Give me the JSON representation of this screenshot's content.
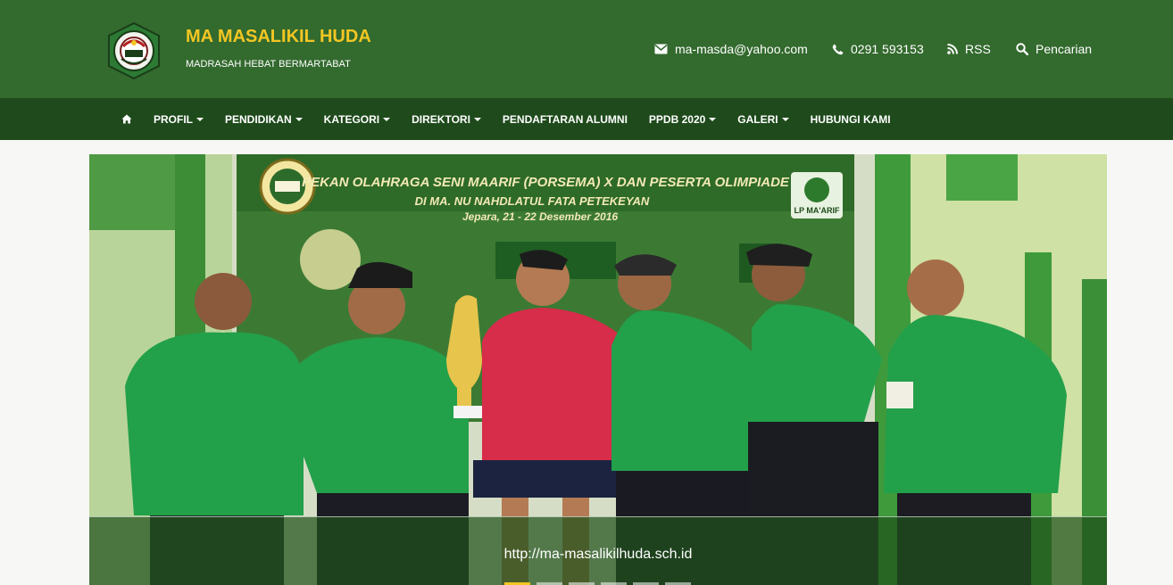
{
  "header": {
    "title": "MA MASALIKIL HUDA",
    "tagline": "MADRASAH HEBAT BERMARTABAT",
    "logo_icon": "school-emblem-icon",
    "title_color": "#f3c623",
    "background_color": "#336a2e"
  },
  "contacts": {
    "email": "ma-masda@yahoo.com",
    "phone": "0291 593153",
    "rss": "RSS",
    "search": "Pencarian"
  },
  "nav": {
    "background_color": "#1f4b1c",
    "items": [
      {
        "label": "PROFIL"
      },
      {
        "label": "PENDIDIKAN"
      },
      {
        "label": "KATEGORI"
      },
      {
        "label": "DIREKTORI"
      },
      {
        "label": "PENDAFTARAN ALUMNI"
      },
      {
        "label": "PPDB 2020"
      },
      {
        "label": "GALERI"
      },
      {
        "label": "HUBUNGI KAMI"
      }
    ]
  },
  "slider": {
    "banner": {
      "line1": "PEKAN OLAHRAGA SENI MAARIF (PORSEMA) X DAN PESERTA OLIMPIADE",
      "line2": "DI MA. NU NAHDLATUL FATA PETEKEYAN",
      "line3": "Jepara, 21 - 22 Desember 2016",
      "badge": "LP MA'ARIF"
    },
    "caption": "http://ma-masalikilhuda.sch.id",
    "active_slide": 1,
    "slide_count": 6
  }
}
